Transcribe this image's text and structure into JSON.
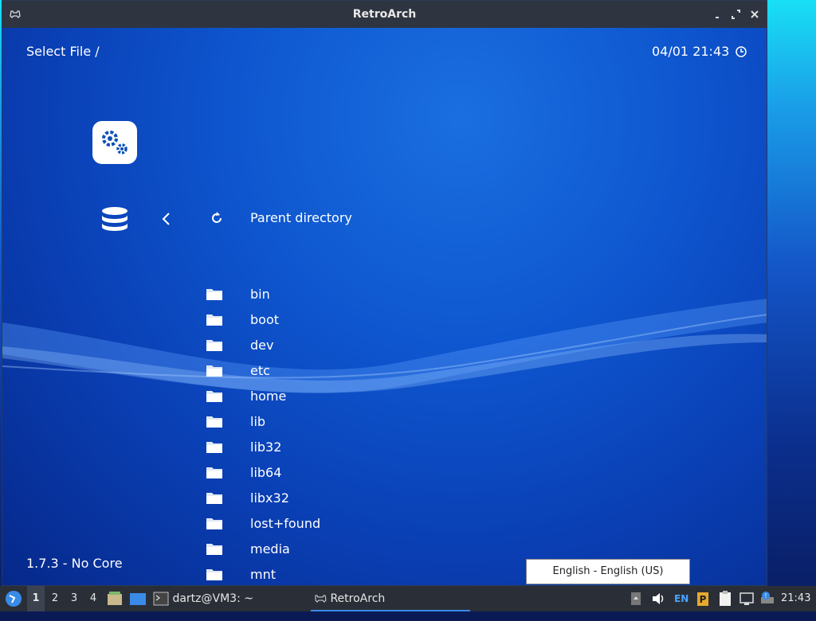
{
  "window": {
    "title": "RetroArch"
  },
  "header": {
    "left": "Select File /",
    "datetime": "04/01 21:43"
  },
  "menu": {
    "parent_label": "Parent directory"
  },
  "files": [
    "bin",
    "boot",
    "dev",
    "etc",
    "home",
    "lib",
    "lib32",
    "lib64",
    "libx32",
    "lost+found",
    "media",
    "mnt"
  ],
  "status": {
    "version": "1.7.3 - No Core"
  },
  "tooltip": {
    "text": "English - English (US)"
  },
  "taskbar": {
    "workspaces": [
      "1",
      "2",
      "3",
      "4"
    ],
    "terminal_label": "dartz@VM3: ~",
    "retroarch_label": "RetroArch",
    "keyboard_layout": "EN",
    "clock": "21:43"
  },
  "colors": {
    "titlebar": "#2e3440",
    "taskbar": "#2a2f37",
    "accent": "#3a8be8"
  }
}
